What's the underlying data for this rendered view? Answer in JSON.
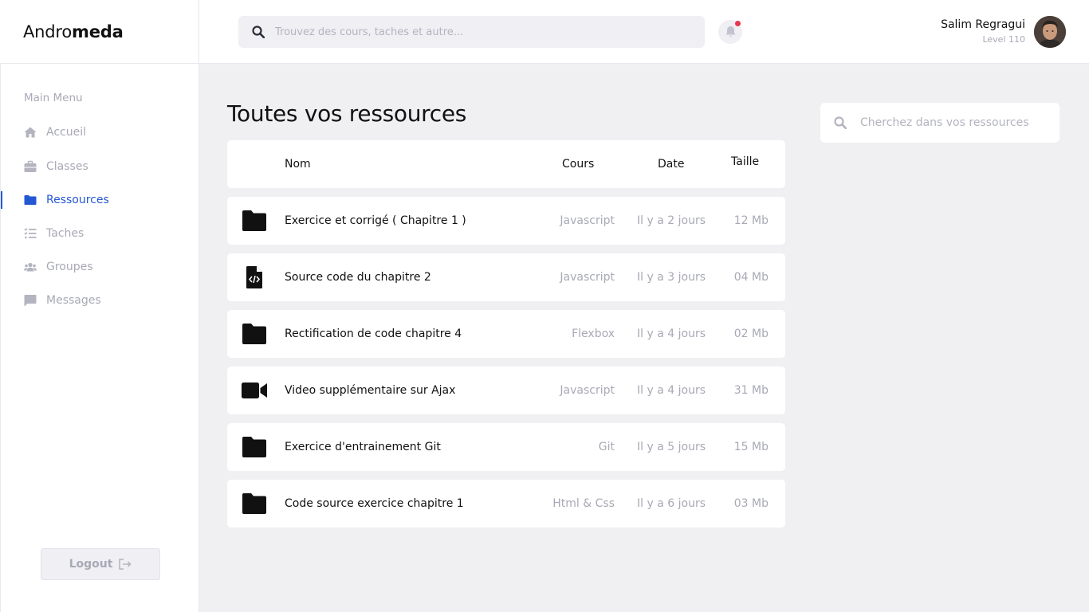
{
  "brand": {
    "part1": "Andro",
    "part2": "meda"
  },
  "search": {
    "placeholder": "Trouvez des cours, taches et autre..."
  },
  "user": {
    "name": "Salim Regragui",
    "level": "Level 110"
  },
  "sidebar": {
    "menu_title": "Main Menu",
    "items": [
      {
        "label": "Accueil",
        "icon": "home-icon"
      },
      {
        "label": "Classes",
        "icon": "briefcase-icon"
      },
      {
        "label": "Ressources",
        "icon": "folder-icon",
        "active": true
      },
      {
        "label": "Taches",
        "icon": "tasks-icon"
      },
      {
        "label": "Groupes",
        "icon": "users-icon"
      },
      {
        "label": "Messages",
        "icon": "message-icon"
      }
    ],
    "logout_label": "Logout"
  },
  "main": {
    "title": "Toutes vos ressources",
    "table": {
      "headers": {
        "name": "Nom",
        "course": "Cours",
        "date": "Date",
        "size": "Taille"
      },
      "rows": [
        {
          "icon": "folder-icon",
          "name": "Exercice et corrigé ( Chapitre 1 )",
          "course": "Javascript",
          "date": "Il y a 2 jours",
          "size": "12 Mb"
        },
        {
          "icon": "code-file-icon",
          "name": "Source code du chapitre 2",
          "course": "Javascript",
          "date": "Il y a 3 jours",
          "size": "04 Mb"
        },
        {
          "icon": "folder-icon",
          "name": "Rectification de code chapitre 4",
          "course": "Flexbox",
          "date": "Il y a 4 jours",
          "size": "02 Mb"
        },
        {
          "icon": "video-icon",
          "name": "Video supplémentaire sur Ajax",
          "course": "Javascript",
          "date": "Il y a 4 jours",
          "size": "31 Mb"
        },
        {
          "icon": "folder-icon",
          "name": "Exercice d'entrainement Git",
          "course": "Git",
          "date": "Il y a 5 jours",
          "size": "15 Mb"
        },
        {
          "icon": "folder-icon",
          "name": "Code source exercice chapitre 1",
          "course": "Html & Css",
          "date": "Il y a 6 jours",
          "size": "03 Mb"
        }
      ]
    },
    "resource_search": {
      "placeholder": "Cherchez dans vos ressources"
    }
  },
  "colors": {
    "accent": "#2458d3",
    "muted": "#a8a9b5",
    "background": "#f0f0f3",
    "notification": "#e8384f"
  }
}
